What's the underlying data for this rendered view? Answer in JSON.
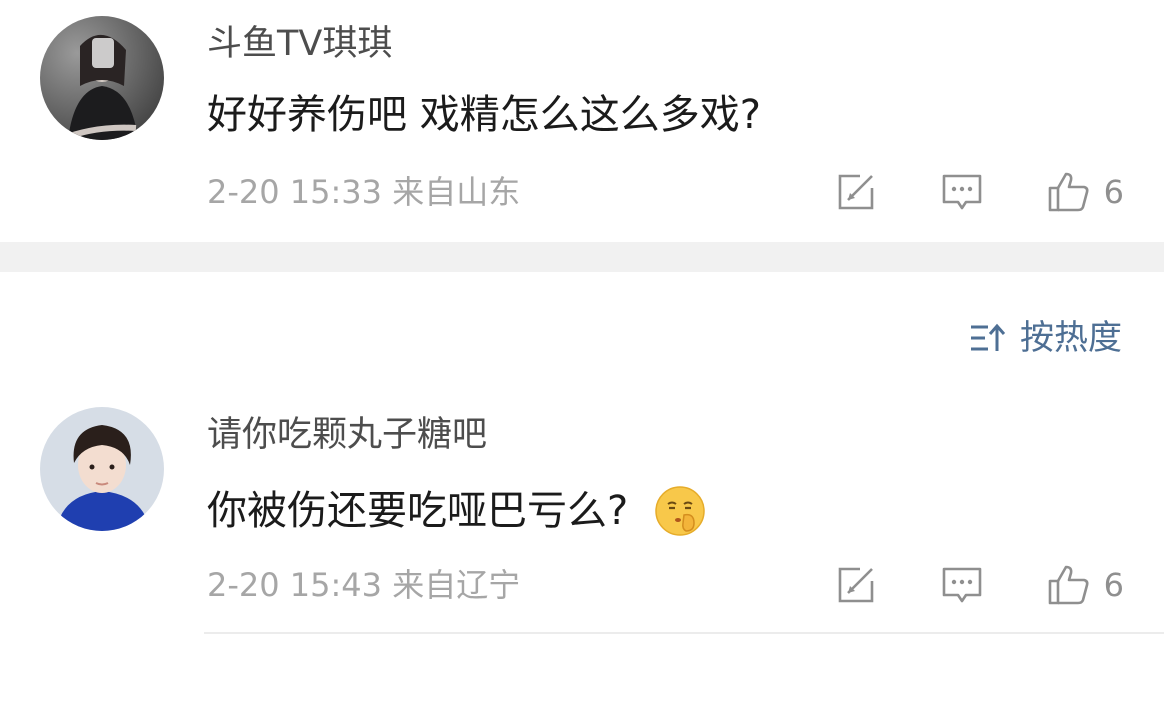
{
  "comments": [
    {
      "username": "斗鱼TV琪琪",
      "text": "好好养伤吧 戏精怎么这么多戏?",
      "time": "2-20 15:33",
      "location": "来自山东",
      "likes": "6",
      "avatar_icon": "avatar-girl-dark-photo",
      "emoji": ""
    },
    {
      "username": "请你吃颗丸子糖吧",
      "text": "你被伤还要吃哑巴亏么?",
      "time": "2-20 15:43",
      "location": "来自辽宁",
      "likes": "6",
      "avatar_icon": "avatar-boy-blue-shirt",
      "emoji": "shush-face-emoji"
    }
  ],
  "sort": {
    "label": "按热度",
    "icon": "sort-icon"
  },
  "icons": {
    "repost": "repost-icon",
    "comment": "comment-icon",
    "like": "thumbs-up-icon"
  },
  "colors": {
    "username": "#4d4d4d",
    "text": "#1b1b1b",
    "meta": "#a6a6a6",
    "icon": "#8f8f8f",
    "sort": "#4e6f94",
    "separator": "#f1f1f1"
  }
}
